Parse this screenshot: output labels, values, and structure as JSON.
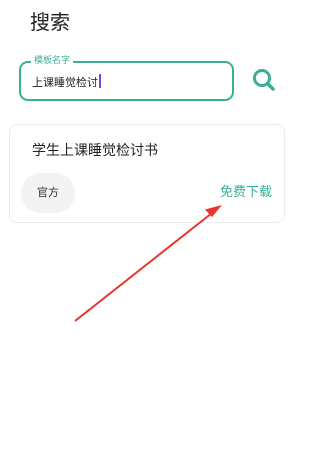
{
  "header": {
    "title": "搜索"
  },
  "search": {
    "label": "模板名字",
    "value": "上课睡觉检讨",
    "button_icon": "search-icon"
  },
  "result_card": {
    "title": "学生上课睡觉检讨书",
    "badge": "官方",
    "download_label": "免费下载"
  },
  "colors": {
    "accent": "#3aaf95",
    "caret": "#7b3fe4",
    "annotation_arrow": "#e8362b"
  }
}
